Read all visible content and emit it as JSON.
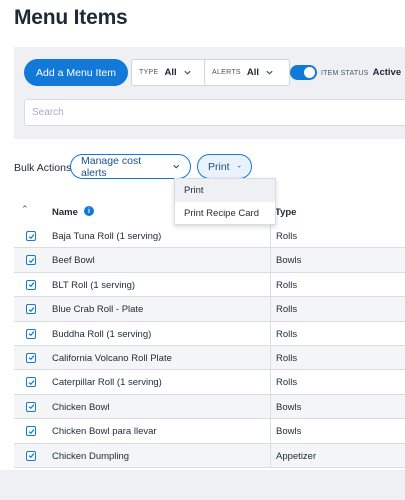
{
  "page": {
    "title": "Menu Items"
  },
  "filters": {
    "add_button": "Add a Menu Item",
    "type": {
      "label": "TYPE",
      "value": "All"
    },
    "alerts": {
      "label": "ALERTS",
      "value": "All"
    },
    "item_status": {
      "label": "ITEM STATUS",
      "value": "Active",
      "enabled": true
    },
    "search_placeholder": "Search"
  },
  "bulk": {
    "label": "Bulk Actions",
    "manage_alerts": "Manage cost alerts",
    "print": "Print"
  },
  "print_menu": {
    "options": [
      "Print",
      "Print Recipe Card"
    ]
  },
  "table": {
    "headers": {
      "name": "Name",
      "type": "Type"
    },
    "rows": [
      {
        "name": "Baja Tuna Roll (1 serving)",
        "type": "Rolls"
      },
      {
        "name": "Beef Bowl",
        "type": "Bowls"
      },
      {
        "name": "BLT Roll (1 serving)",
        "type": "Rolls"
      },
      {
        "name": "Blue Crab Roll - Plate",
        "type": "Rolls"
      },
      {
        "name": "Buddha Roll (1 serving)",
        "type": "Rolls"
      },
      {
        "name": "California Volcano Roll Plate",
        "type": "Rolls"
      },
      {
        "name": "Caterpillar Roll (1 serving)",
        "type": "Rolls"
      },
      {
        "name": "Chicken Bowl",
        "type": "Bowls"
      },
      {
        "name": "Chicken Bowl para llevar",
        "type": "Bowls"
      },
      {
        "name": "Chicken Dumpling",
        "type": "Appetizer"
      }
    ]
  },
  "colors": {
    "accent": "#1379d8",
    "panel": "#eef0f3",
    "text": "#1f2a37"
  }
}
